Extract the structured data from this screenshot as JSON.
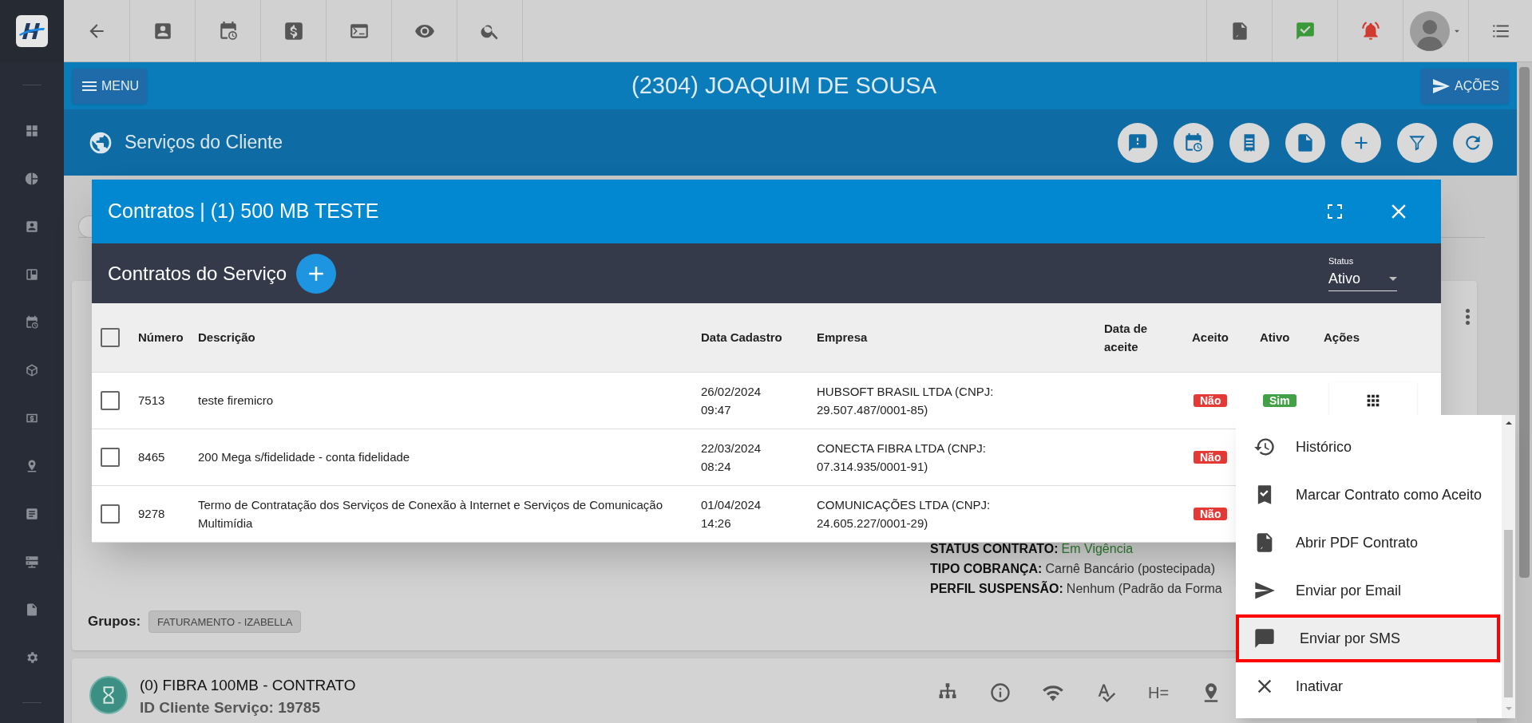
{
  "header": {
    "menu_button": "MENU",
    "customer_title": "(2304) JOAQUIM DE SOUSA",
    "actions_button": "AÇÕES"
  },
  "section": {
    "title": "Serviços do Cliente"
  },
  "service_card": {
    "details": [
      {
        "label": "STATUS CONTRATO:",
        "value": "Em Vigência",
        "color": "#2e7d32"
      },
      {
        "label": "TIPO COBRANÇA:",
        "value": "Carnê Bancário (postecipada)",
        "color": "#333333"
      },
      {
        "label": "PERFIL SUSPENSÃO:",
        "value": "Nenhum (Padrão da Forma",
        "color": "#333333"
      }
    ],
    "groups_label": "Grupos:",
    "groups": [
      "FATURAMENTO - IZABELLA"
    ]
  },
  "second_service": {
    "title": "(0) FIBRA 100MB - CONTRATO",
    "id_line": "ID Cliente Serviço: 19785",
    "action_text": "H="
  },
  "modal": {
    "title": "Contratos | (1) 500 MB TESTE",
    "subtitle": "Contratos do Serviço",
    "status_filter": {
      "label": "Status",
      "value": "Ativo"
    },
    "select_all_checked": false,
    "columns": [
      "Número",
      "Descrição",
      "Data Cadastro",
      "Empresa",
      "Data de aceite",
      "Aceito",
      "Ativo",
      "Ações"
    ],
    "rows": [
      {
        "checked": false,
        "number": "7513",
        "description": "teste firemicro",
        "date": [
          "26/02/2024",
          "09:47"
        ],
        "company": [
          "HUBSOFT BRASIL LTDA (CNPJ:",
          "29.507.487/0001-85)"
        ],
        "accepted": {
          "text": "Não",
          "positive": false
        },
        "active": {
          "text": "Sim",
          "positive": true
        },
        "actions_button": true
      },
      {
        "checked": false,
        "number": "8465",
        "description": "200 Mega s/fidelidade - conta fidelidade",
        "date": [
          "22/03/2024",
          "08:24"
        ],
        "company": [
          "CONECTA FIBRA LTDA (CNPJ:",
          "07.314.935/0001-91)"
        ],
        "accepted": {
          "text": "Não",
          "positive": false
        }
      },
      {
        "checked": false,
        "number": "9278",
        "description": "Termo de Contratação dos Serviços de Conexão à Internet e Serviços de Comunicação Multimídia",
        "date": [
          "01/04/2024",
          "14:26"
        ],
        "company": [
          "COMUNICAÇÕES LTDA (CNPJ:",
          "24.605.227/0001-29)"
        ],
        "accepted": {
          "text": "Não",
          "positive": false
        }
      }
    ]
  },
  "actions_menu": [
    {
      "kind": "history",
      "label": "Histórico",
      "highlighted": false
    },
    {
      "kind": "accept",
      "label": "Marcar Contrato como Aceito",
      "highlighted": false
    },
    {
      "kind": "pdf",
      "label": "Abrir PDF Contrato",
      "highlighted": false
    },
    {
      "kind": "email",
      "label": "Enviar por Email",
      "highlighted": false
    },
    {
      "kind": "sms",
      "label": "Enviar por SMS",
      "highlighted": true
    },
    {
      "kind": "deactivate",
      "label": "Inativar",
      "highlighted": false
    }
  ]
}
